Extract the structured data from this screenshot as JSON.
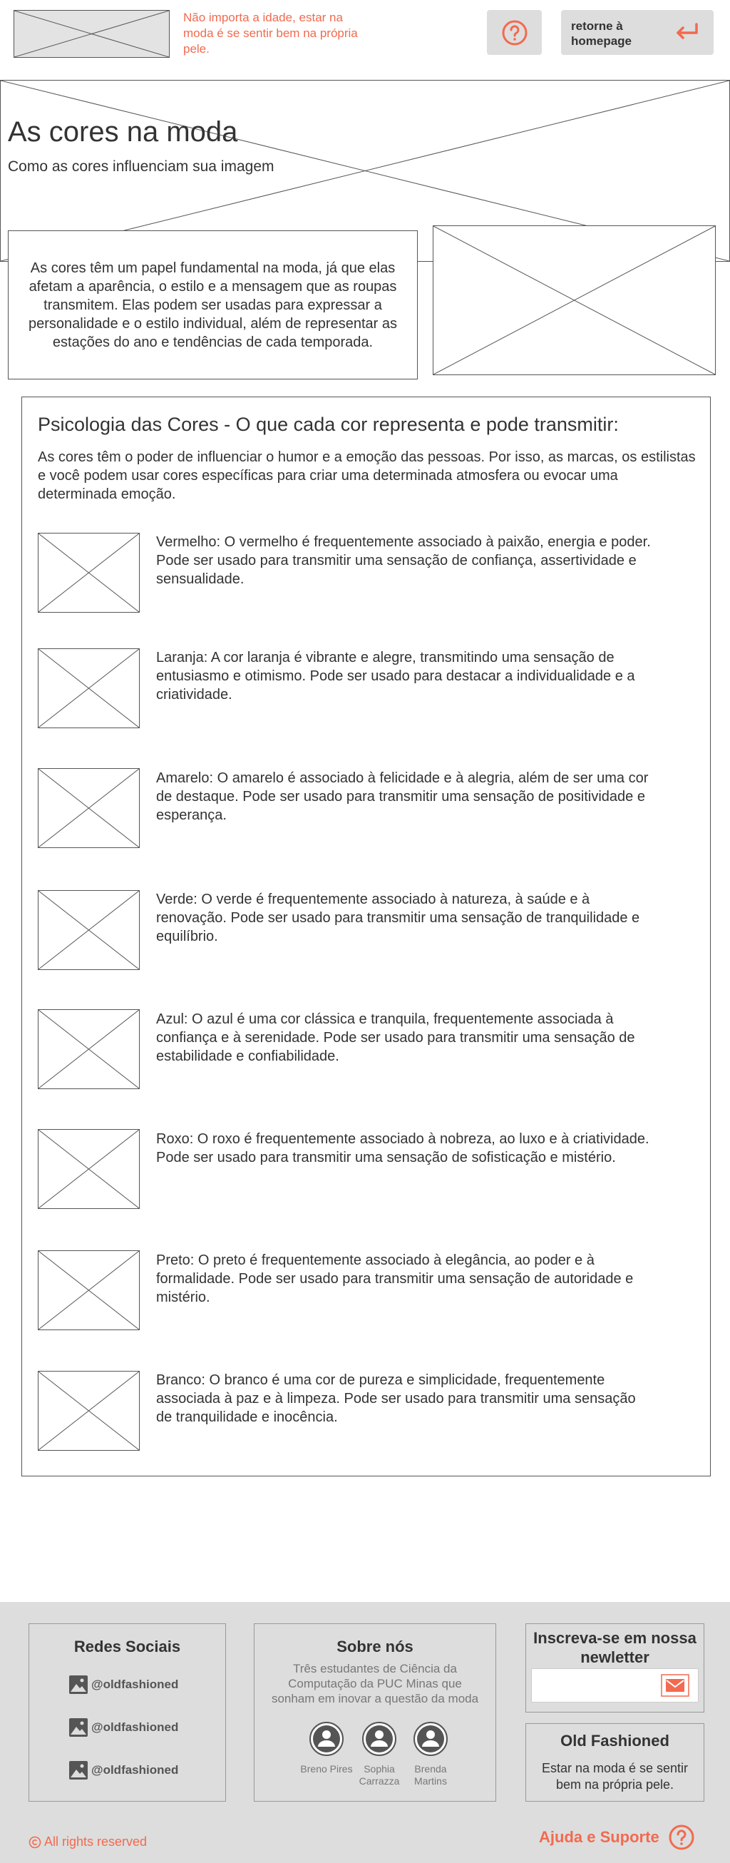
{
  "header": {
    "tagline": "Não importa a idade, estar na moda é se sentir bem na própria pele.",
    "help_icon": "question-circle-icon",
    "home_button_label": "retorne à homepage",
    "home_icon": "return-arrow-icon"
  },
  "hero": {
    "title": "As cores na moda",
    "subtitle": "Como as cores influenciam sua imagem"
  },
  "intro": {
    "text": "As cores têm um papel fundamental na moda, já que elas afetam a aparência, o estilo e a mensagem que as roupas transmitem. Elas podem ser usadas para expressar a personalidade e o estilo individual, além de representar as estações do ano e tendências de cada temporada."
  },
  "psychology": {
    "title": "Psicologia das Cores - O que cada cor representa e pode transmitir:",
    "intro": "As cores têm o poder de influenciar o humor e a emoção das pessoas. Por isso, as marcas, os estilistas e você podem usar cores específicas para criar uma determinada atmosfera ou evocar uma determinada emoção.",
    "colors": [
      {
        "text": "Vermelho: O vermelho é frequentemente associado à paixão, energia e poder. Pode ser usado para transmitir uma sensação de confiança, assertividade e sensualidade."
      },
      {
        "text": "Laranja: A cor laranja é vibrante e alegre, transmitindo uma sensação de entusiasmo e otimismo. Pode ser usado para destacar a individualidade e a criatividade."
      },
      {
        "text": "Amarelo: O amarelo é associado à felicidade e à alegria, além de ser uma cor de destaque. Pode ser usado para transmitir uma sensação de positividade e esperança."
      },
      {
        "text": "Verde: O verde é frequentemente associado à natureza, à saúde e à renovação. Pode ser usado para transmitir uma sensação de tranquilidade e equilíbrio."
      },
      {
        "text": "Azul: O azul é uma cor clássica e tranquila, frequentemente associada à confiança e à serenidade. Pode ser usado para transmitir uma sensação de estabilidade e confiabilidade."
      },
      {
        "text": "Roxo: O roxo é frequentemente associado à nobreza, ao luxo e à criatividade. Pode ser usado para transmitir uma sensação de sofisticação e mistério."
      },
      {
        "text": "Preto: O preto é frequentemente associado à elegância, ao poder e à formalidade. Pode ser usado para transmitir uma sensação de autoridade e mistério."
      },
      {
        "text": "Branco: O branco é uma cor de pureza e simplicidade, frequentemente associada à paz e à limpeza. Pode ser usado para transmitir uma sensação de tranquilidade e inocência."
      }
    ]
  },
  "footer": {
    "social": {
      "title": "Redes Sociais",
      "links": [
        {
          "icon": "image-icon",
          "handle": "@oldfashioned"
        },
        {
          "icon": "image-icon",
          "handle": "@oldfashioned"
        },
        {
          "icon": "image-icon",
          "handle": "@oldfashioned"
        }
      ]
    },
    "about": {
      "title": "Sobre nós",
      "text": "Três estudantes de Ciência da Computação da PUC Minas que sonham em inovar a questão da moda",
      "members": [
        {
          "name": "Breno Pires"
        },
        {
          "name": "Sophia Carrazza"
        },
        {
          "name": "Brenda Martins"
        }
      ]
    },
    "newsletter": {
      "title": "Inscreva-se em nossa newletter",
      "email_value": "",
      "submit_icon": "mail-icon"
    },
    "brand": {
      "title": "Old Fashioned",
      "text": "Estar na moda é se sentir bem na própria pele."
    },
    "copyright": "All rights reserved",
    "support_label": "Ajuda e Suporte"
  },
  "colors": {
    "accent": "#f26a4f",
    "footer_bg": "#dddddd",
    "button_bg": "#dddddd",
    "text": "#333333"
  }
}
